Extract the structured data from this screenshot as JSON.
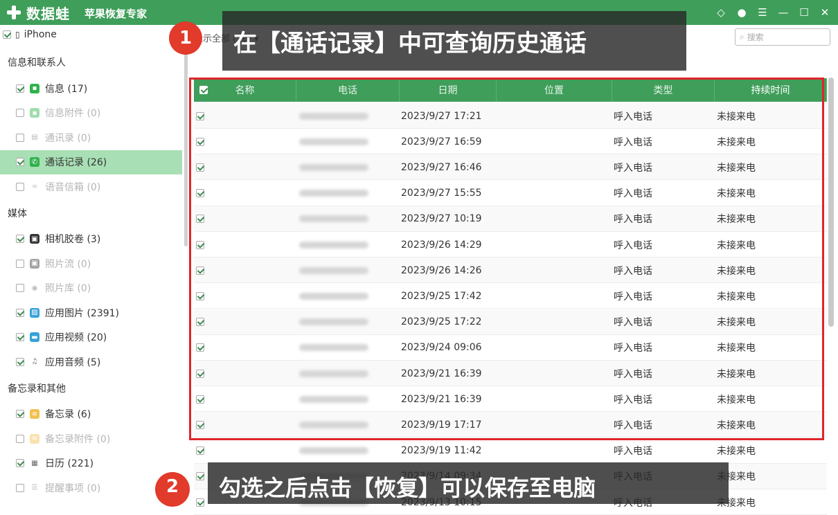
{
  "app": {
    "brand": "数据蛙",
    "title": "苹果恢复专家"
  },
  "window_icons": [
    "diamond-icon",
    "chat-icon",
    "menu-icon",
    "minimize-icon",
    "maximize-icon",
    "close-icon"
  ],
  "window_icon_glyphs": [
    "◇",
    "●",
    "☰",
    "—",
    "☐",
    "✕"
  ],
  "device": {
    "label": "iPhone",
    "checked": true
  },
  "sidebar": {
    "sections": [
      {
        "title": "信息和联系人",
        "items": [
          {
            "label": "信息 (17)",
            "checked": true,
            "dim": false,
            "icon": "message-icon"
          },
          {
            "label": "信息附件 (0)",
            "checked": false,
            "dim": true,
            "icon": "attachment-icon"
          },
          {
            "label": "通讯录 (0)",
            "checked": false,
            "dim": true,
            "icon": "contacts-icon"
          },
          {
            "label": "通话记录 (26)",
            "checked": true,
            "dim": false,
            "active": true,
            "icon": "phone-icon"
          },
          {
            "label": "语音信箱 (0)",
            "checked": false,
            "dim": true,
            "icon": "voicemail-icon"
          }
        ]
      },
      {
        "title": "媒体",
        "items": [
          {
            "label": "相机胶卷 (3)",
            "checked": true,
            "dim": false,
            "icon": "camera-icon"
          },
          {
            "label": "照片流 (0)",
            "checked": false,
            "dim": true,
            "icon": "photostream-icon"
          },
          {
            "label": "照片库 (0)",
            "checked": false,
            "dim": true,
            "icon": "photo-library-icon"
          },
          {
            "label": "应用图片 (2391)",
            "checked": true,
            "dim": false,
            "icon": "app-photo-icon"
          },
          {
            "label": "应用视频 (20)",
            "checked": true,
            "dim": false,
            "icon": "app-video-icon"
          },
          {
            "label": "应用音频 (5)",
            "checked": true,
            "dim": false,
            "icon": "music-note-icon"
          }
        ]
      },
      {
        "title": "备忘录和其他",
        "items": [
          {
            "label": "备忘录 (6)",
            "checked": true,
            "dim": false,
            "icon": "notes-icon"
          },
          {
            "label": "备忘录附件 (0)",
            "checked": false,
            "dim": true,
            "icon": "notes-attachment-icon"
          },
          {
            "label": "日历 (221)",
            "checked": true,
            "dim": false,
            "icon": "calendar-icon"
          },
          {
            "label": "提醒事项 (0)",
            "checked": false,
            "dim": true,
            "icon": "reminders-icon"
          }
        ]
      }
    ]
  },
  "toolbar": {
    "filter_label": "显示全部 (26)",
    "search_placeholder": "搜索"
  },
  "table": {
    "columns": [
      "名称",
      "电话",
      "日期",
      "位置",
      "类型",
      "持续时间"
    ],
    "rows": [
      {
        "date": "2023/9/27 17:21",
        "type": "呼入电话",
        "duration": "未接来电"
      },
      {
        "date": "2023/9/27 16:59",
        "type": "呼入电话",
        "duration": "未接来电"
      },
      {
        "date": "2023/9/27 16:46",
        "type": "呼入电话",
        "duration": "未接来电"
      },
      {
        "date": "2023/9/27 15:55",
        "type": "呼入电话",
        "duration": "未接来电"
      },
      {
        "date": "2023/9/27 10:19",
        "type": "呼入电话",
        "duration": "未接来电"
      },
      {
        "date": "2023/9/26 14:29",
        "type": "呼入电话",
        "duration": "未接来电"
      },
      {
        "date": "2023/9/26 14:26",
        "type": "呼入电话",
        "duration": "未接来电"
      },
      {
        "date": "2023/9/25 17:42",
        "type": "呼入电话",
        "duration": "未接来电"
      },
      {
        "date": "2023/9/25 17:22",
        "type": "呼入电话",
        "duration": "未接来电"
      },
      {
        "date": "2023/9/24 09:06",
        "type": "呼入电话",
        "duration": "未接来电"
      },
      {
        "date": "2023/9/21 16:39",
        "type": "呼入电话",
        "duration": "未接来电"
      },
      {
        "date": "2023/9/21 16:39",
        "type": "呼入电话",
        "duration": "未接来电"
      },
      {
        "date": "2023/9/19 17:17",
        "type": "呼入电话",
        "duration": "未接来电"
      },
      {
        "date": "2023/9/19 11:42",
        "type": "呼入电话",
        "duration": "未接来电"
      },
      {
        "date": "2023/9/14 09:34",
        "type": "呼入电话",
        "duration": "未接来电"
      },
      {
        "date": "2023/9/13 10:15",
        "type": "呼入电话",
        "duration": "未接来电"
      }
    ]
  },
  "annotations": {
    "step1_number": "1",
    "step1_text": "在【通话记录】中可查询历史通话",
    "step2_number": "2",
    "step2_text": "勾选之后点击【恢复】可以保存至电脑"
  },
  "colors": {
    "brand_green": "#3f9e5a",
    "highlight": "#a8dfb5",
    "annotation_red": "#e23a2b"
  }
}
